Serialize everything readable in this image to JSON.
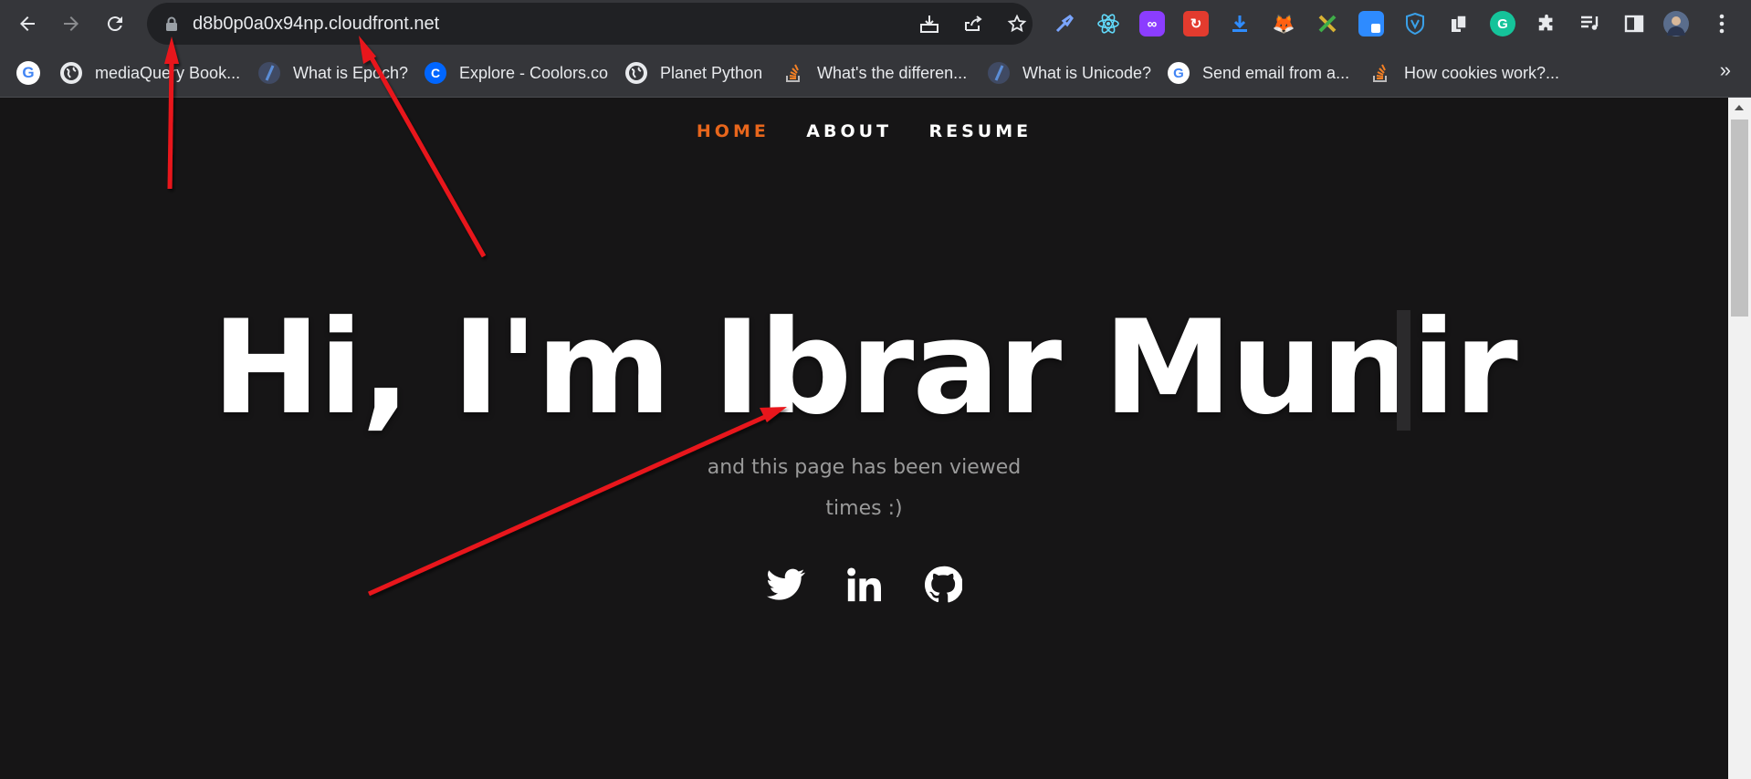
{
  "browser": {
    "url": "d8b0p0a0x94np.cloudfront.net",
    "bookmarks": [
      {
        "label": "mediaQuery Book...",
        "icon": "globe-icon"
      },
      {
        "label": "What is Epoch?",
        "icon": "epoch-icon"
      },
      {
        "label": "Explore - Coolors.co",
        "icon": "coolors-icon"
      },
      {
        "label": "Planet Python",
        "icon": "globe-icon"
      },
      {
        "label": "What's the differen...",
        "icon": "stackoverflow-icon"
      },
      {
        "label": "What is Unicode?",
        "icon": "epoch-icon"
      },
      {
        "label": "Send email from a...",
        "icon": "google-icon"
      },
      {
        "label": "How cookies work?...",
        "icon": "stackoverflow-icon"
      }
    ],
    "more_label": "»"
  },
  "site": {
    "nav": {
      "home": "HOME",
      "about": "ABOUT",
      "resume": "RESUME"
    },
    "accent_color": "#e8661c",
    "heading": "Hi, I'm Ibrar Munir",
    "subtitle_line1": "and this page has been viewed",
    "subtitle_line2": "times :)",
    "social": [
      "twitter-icon",
      "linkedin-icon",
      "github-icon"
    ]
  },
  "annotation_color": "#e8181a"
}
